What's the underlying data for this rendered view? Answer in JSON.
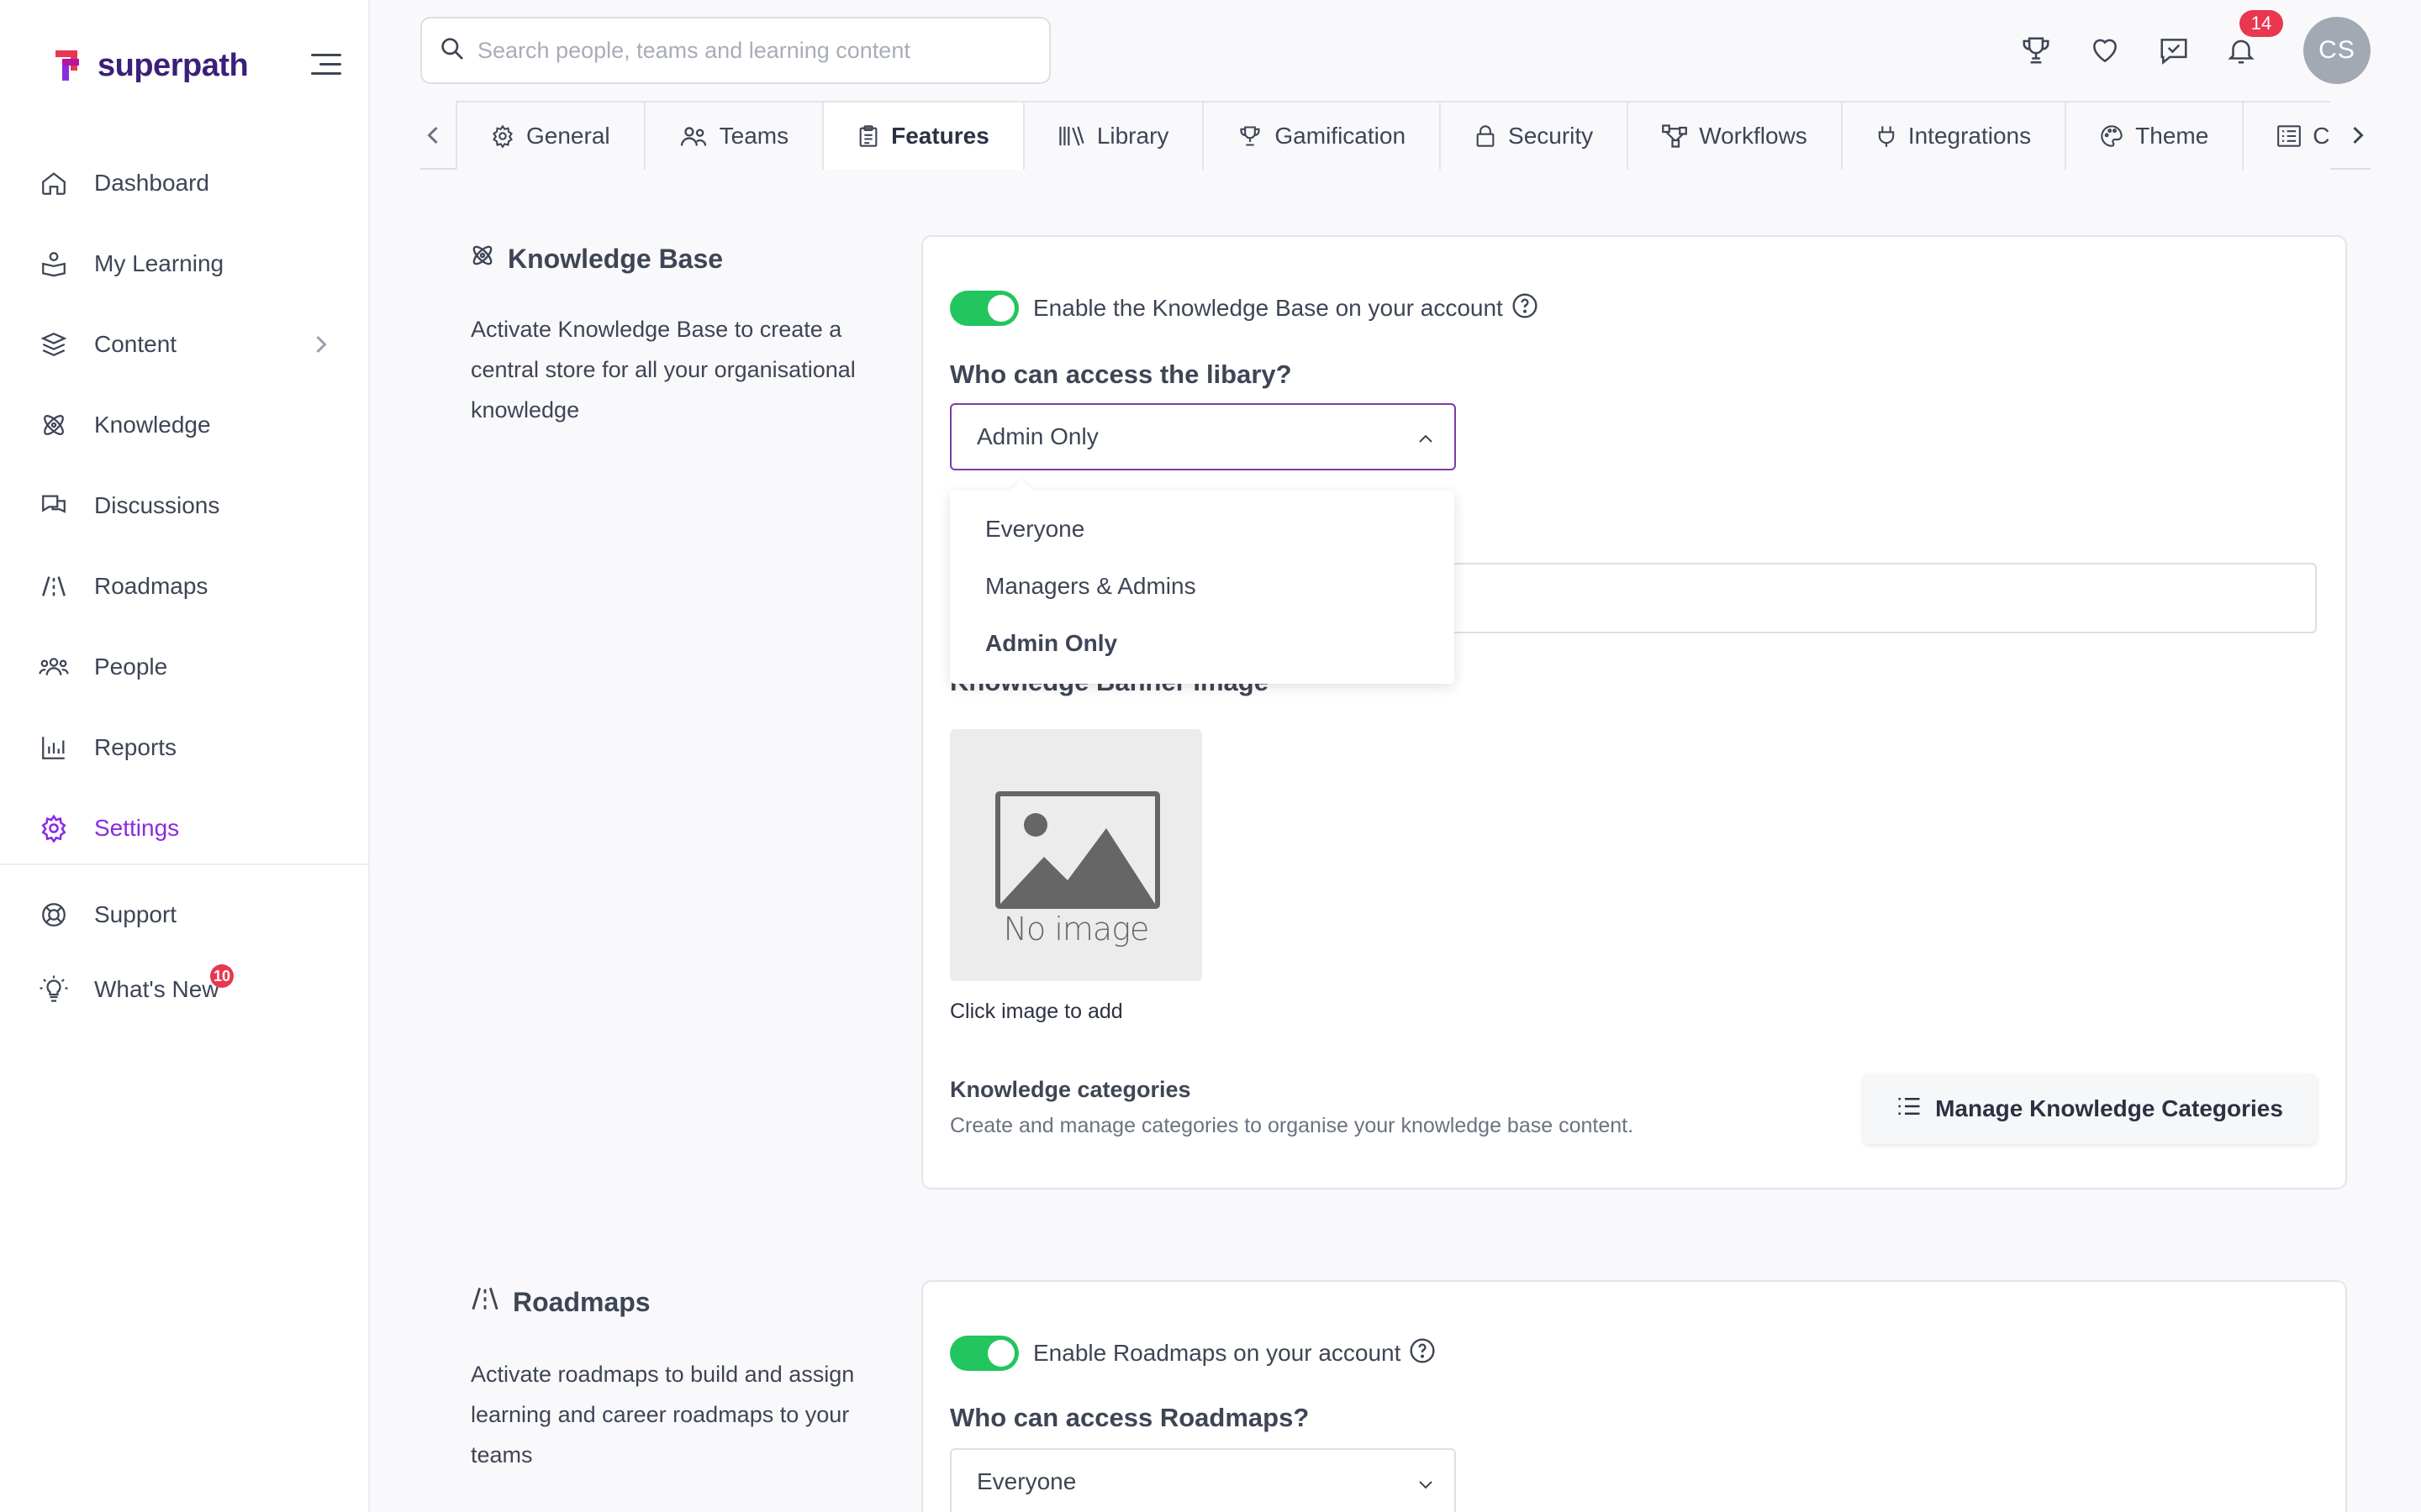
{
  "app": {
    "logo_text": "superpath"
  },
  "sidebar": {
    "items": [
      {
        "label": "Dashboard",
        "icon": "home-icon"
      },
      {
        "label": "My Learning",
        "icon": "learning-icon"
      },
      {
        "label": "Content",
        "icon": "layers-icon"
      },
      {
        "label": "Knowledge",
        "icon": "atom-icon"
      },
      {
        "label": "Discussions",
        "icon": "chat-icon"
      },
      {
        "label": "Roadmaps",
        "icon": "road-icon"
      },
      {
        "label": "People",
        "icon": "people-icon"
      },
      {
        "label": "Reports",
        "icon": "bar-chart-icon"
      },
      {
        "label": "Settings",
        "icon": "gear-icon",
        "active": true
      }
    ],
    "secondary": [
      {
        "label": "Support",
        "icon": "lifebuoy-icon"
      },
      {
        "label": "What's New",
        "icon": "lightbulb-icon",
        "badge": "10"
      }
    ]
  },
  "search": {
    "placeholder": "Search people, teams and learning content"
  },
  "header": {
    "notification_count": "14",
    "avatar_initials": "CS"
  },
  "tabs": [
    {
      "label": "General",
      "icon": "gear-icon"
    },
    {
      "label": "Teams",
      "icon": "people-icon"
    },
    {
      "label": "Features",
      "icon": "clipboard-icon",
      "active": true
    },
    {
      "label": "Library",
      "icon": "library-icon"
    },
    {
      "label": "Gamification",
      "icon": "trophy-icon"
    },
    {
      "label": "Security",
      "icon": "lock-icon"
    },
    {
      "label": "Workflows",
      "icon": "workflow-icon"
    },
    {
      "label": "Integrations",
      "icon": "plug-icon"
    },
    {
      "label": "Theme",
      "icon": "palette-icon"
    },
    {
      "label": "Cus",
      "icon": "list-icon"
    }
  ],
  "knowledge": {
    "title": "Knowledge Base",
    "description": "Activate Knowledge Base to create a central store for all your organisational knowledge",
    "toggle_label": "Enable the Knowledge Base on your account",
    "access_label": "Who can access the libary?",
    "access_value": "Admin Only",
    "options": [
      "Everyone",
      "Managers & Admins",
      "Admin Only"
    ],
    "banner_label": "Knowledge Banner Image",
    "no_image": "No image",
    "click_to_add": "Click image to add",
    "categories_title": "Knowledge categories",
    "categories_desc": "Create and manage categories to organise your knowledge base content.",
    "manage_button": "Manage Knowledge Categories"
  },
  "roadmaps": {
    "title": "Roadmaps",
    "description": "Activate roadmaps to build and assign learning and career roadmaps to your teams",
    "toggle_label": "Enable Roadmaps on your account",
    "access_label": "Who can access Roadmaps?",
    "access_value": "Everyone"
  },
  "colors": {
    "accent": "#8a2be2",
    "toggle_on": "#22c55e",
    "badge": "#e8374f"
  }
}
